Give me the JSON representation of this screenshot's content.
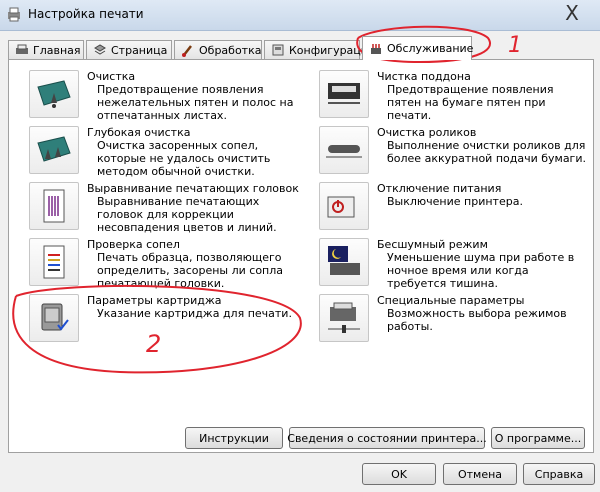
{
  "window": {
    "title": "Настройка печати",
    "close_symbol": "X"
  },
  "tabs": [
    {
      "label": "Главная",
      "icon": "main-tab-icon"
    },
    {
      "label": "Страница",
      "icon": "page-tab-icon"
    },
    {
      "label": "Обработка",
      "icon": "processing-tab-icon"
    },
    {
      "label": "Конфигурации",
      "icon": "config-tab-icon"
    },
    {
      "label": "Обслуживание",
      "icon": "maintenance-tab-icon",
      "active": true
    }
  ],
  "items_left": [
    {
      "title": "Очистка",
      "desc": "Предотвращение появления нежелательных пятен и полос на отпечатанных листах."
    },
    {
      "title": "Глубокая очистка",
      "desc": "Очистка засоренных сопел, которые не удалось очистить методом обычной очистки."
    },
    {
      "title": "Выравнивание печатающих головок",
      "desc": "Выравнивание печатающих головок для коррекции несовпадения цветов и линий."
    },
    {
      "title": "Проверка сопел",
      "desc": "Печать образца, позволяющего определить, засорены ли сопла печатающей головки."
    },
    {
      "title": "Параметры картриджа",
      "desc": "Указание картриджа для печати."
    }
  ],
  "items_right": [
    {
      "title": "Чистка поддона",
      "desc": "Предотвращение появления пятен на бумаге пятен при печати."
    },
    {
      "title": "Очистка роликов",
      "desc": "Выполнение очистки роликов для более аккуратной подачи бумаги."
    },
    {
      "title": "Отключение питания",
      "desc": "Выключение принтера."
    },
    {
      "title": "Бесшумный режим",
      "desc": "Уменьшение шума при работе в ночное время или когда требуется тишина."
    },
    {
      "title": "Специальные параметры",
      "desc": "Возможность выбора режимов работы."
    }
  ],
  "panel_buttons": {
    "instructions": "Инструкции",
    "status": "Сведения о состоянии принтера...",
    "about": "О программе..."
  },
  "dialog_buttons": {
    "ok": "OK",
    "cancel": "Отмена",
    "help": "Справка"
  },
  "annotations": {
    "mark1": "1",
    "mark2": "2"
  },
  "colors": {
    "annotation": "#e0242e",
    "tab_active_bg": "#ffffff",
    "icon_teal": "#2f7f7a"
  }
}
